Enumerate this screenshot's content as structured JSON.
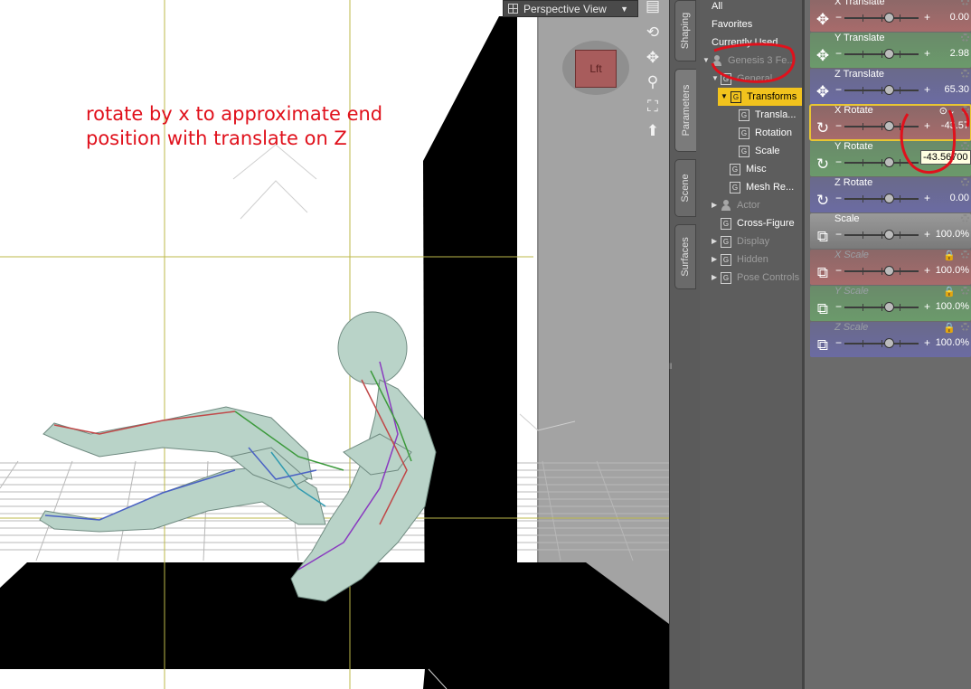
{
  "viewport": {
    "annotation_lines": [
      "rotate by x to approximate end",
      "position with translate on Z"
    ],
    "view_label": "Perspective View",
    "cube_label": "Lft"
  },
  "tabs": [
    "Shaping",
    "Parameters",
    "Scene",
    "Surfaces"
  ],
  "tree": {
    "rows": [
      {
        "label": "All"
      },
      {
        "label": "Favorites"
      },
      {
        "label": "Currently Used"
      },
      {
        "label": "Genesis 3 Fe..."
      },
      {
        "label": "General"
      },
      {
        "label": "Transforms"
      },
      {
        "label": "Transla..."
      },
      {
        "label": "Rotation"
      },
      {
        "label": "Scale"
      },
      {
        "label": "Misc"
      },
      {
        "label": "Mesh Re..."
      },
      {
        "label": "Actor"
      },
      {
        "label": "Cross-Figure"
      },
      {
        "label": "Display"
      },
      {
        "label": "Hidden"
      },
      {
        "label": "Pose Controls"
      }
    ]
  },
  "params": [
    {
      "name": "X Translate",
      "value": "0.00",
      "slider": 0.5
    },
    {
      "name": "Y Translate",
      "value": "2.98",
      "slider": 0.5
    },
    {
      "name": "Z Translate",
      "value": "65.30",
      "slider": 0.5
    },
    {
      "name": "X Rotate",
      "value": "-43.57",
      "slider": 0.5
    },
    {
      "name": "Y Rotate",
      "value": "",
      "slider": 0.5
    },
    {
      "name": "Z Rotate",
      "value": "0.00",
      "slider": 0.5
    },
    {
      "name": "Scale",
      "value": "100.0%",
      "slider": 0.5
    },
    {
      "name": "X Scale",
      "value": "100.0%",
      "slider": 0.5
    },
    {
      "name": "Y Scale",
      "value": "100.0%",
      "slider": 0.5
    },
    {
      "name": "Z Scale",
      "value": "100.0%",
      "slider": 0.5
    }
  ],
  "tooltip": "-43.56700",
  "colors": {
    "annotation": "#e0111c",
    "selected_row": "#f2c31d",
    "translate_x": "#a86b6b",
    "translate_y": "#6b9a6b",
    "translate_z": "#6b6ba2",
    "scale": "#8a8a8a"
  }
}
